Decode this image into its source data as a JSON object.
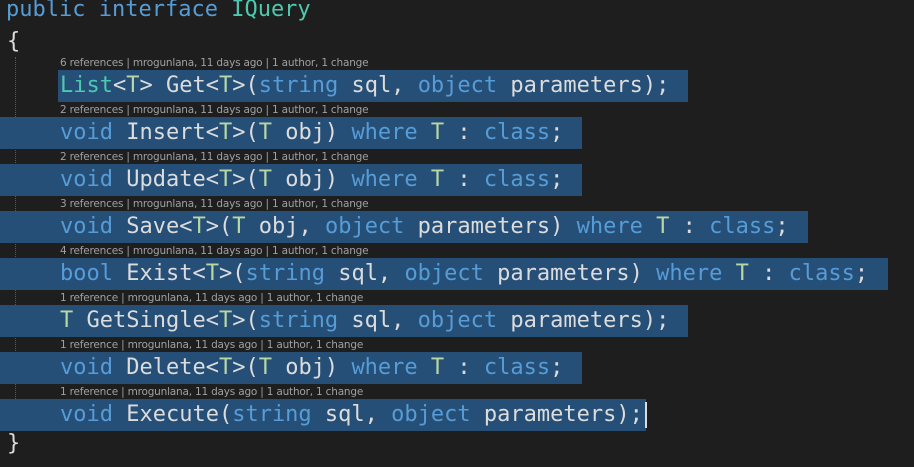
{
  "header": {
    "kw_public": "public",
    "kw_interface": "interface",
    "name": "IQuery"
  },
  "braces": {
    "open": "{",
    "close": "}"
  },
  "members": [
    {
      "lens": "6 references | mrogunlana, 11 days ago | 1 author, 1 change",
      "tokens": [
        "List",
        "<",
        "T",
        ">",
        " Get",
        "<",
        "T",
        ">(",
        "string",
        " sql, ",
        "object",
        " parameters);"
      ]
    },
    {
      "lens": "2 references | mrogunlana, 11 days ago | 1 author, 1 change",
      "tokens": [
        "void",
        " Insert",
        "<",
        "T",
        ">(",
        "T",
        " obj) ",
        "where",
        " ",
        "T",
        " : ",
        "class",
        ";"
      ]
    },
    {
      "lens": "2 references | mrogunlana, 11 days ago | 1 author, 1 change",
      "tokens": [
        "void",
        " Update",
        "<",
        "T",
        ">(",
        "T",
        " obj) ",
        "where",
        " ",
        "T",
        " : ",
        "class",
        ";"
      ]
    },
    {
      "lens": "3 references | mrogunlana, 11 days ago | 1 author, 1 change",
      "tokens": [
        "void",
        " Save",
        "<",
        "T",
        ">(",
        "T",
        " obj, ",
        "object",
        " parameters) ",
        "where",
        " ",
        "T",
        " : ",
        "class",
        ";"
      ]
    },
    {
      "lens": "4 references | mrogunlana, 11 days ago | 1 author, 1 change",
      "tokens": [
        "bool",
        " Exist",
        "<",
        "T",
        ">(",
        "string",
        " sql, ",
        "object",
        " parameters) ",
        "where",
        " ",
        "T",
        " : ",
        "class",
        ";"
      ]
    },
    {
      "lens": "1 reference | mrogunlana, 11 days ago | 1 author, 1 change",
      "tokens": [
        "T",
        " GetSingle",
        "<",
        "T",
        ">(",
        "string",
        " sql, ",
        "object",
        " parameters);"
      ]
    },
    {
      "lens": "1 reference | mrogunlana, 11 days ago | 1 author, 1 change",
      "tokens": [
        "void",
        " Delete",
        "<",
        "T",
        ">(",
        "T",
        " obj) ",
        "where",
        " ",
        "T",
        " : ",
        "class",
        ";"
      ]
    },
    {
      "lens": "1 reference | mrogunlana, 11 days ago | 1 author, 1 change",
      "tokens": [
        "void",
        " Execute(",
        "string",
        " sql, ",
        "object",
        " parameters);"
      ]
    }
  ],
  "colors": {
    "background": "#1e1e1e",
    "selection": "#264f78",
    "keyword": "#569cd6",
    "type": "#4ec9b0",
    "type_param": "#b8d7a3",
    "plain": "#dcdcdc",
    "codelens": "#a0a0a0"
  }
}
